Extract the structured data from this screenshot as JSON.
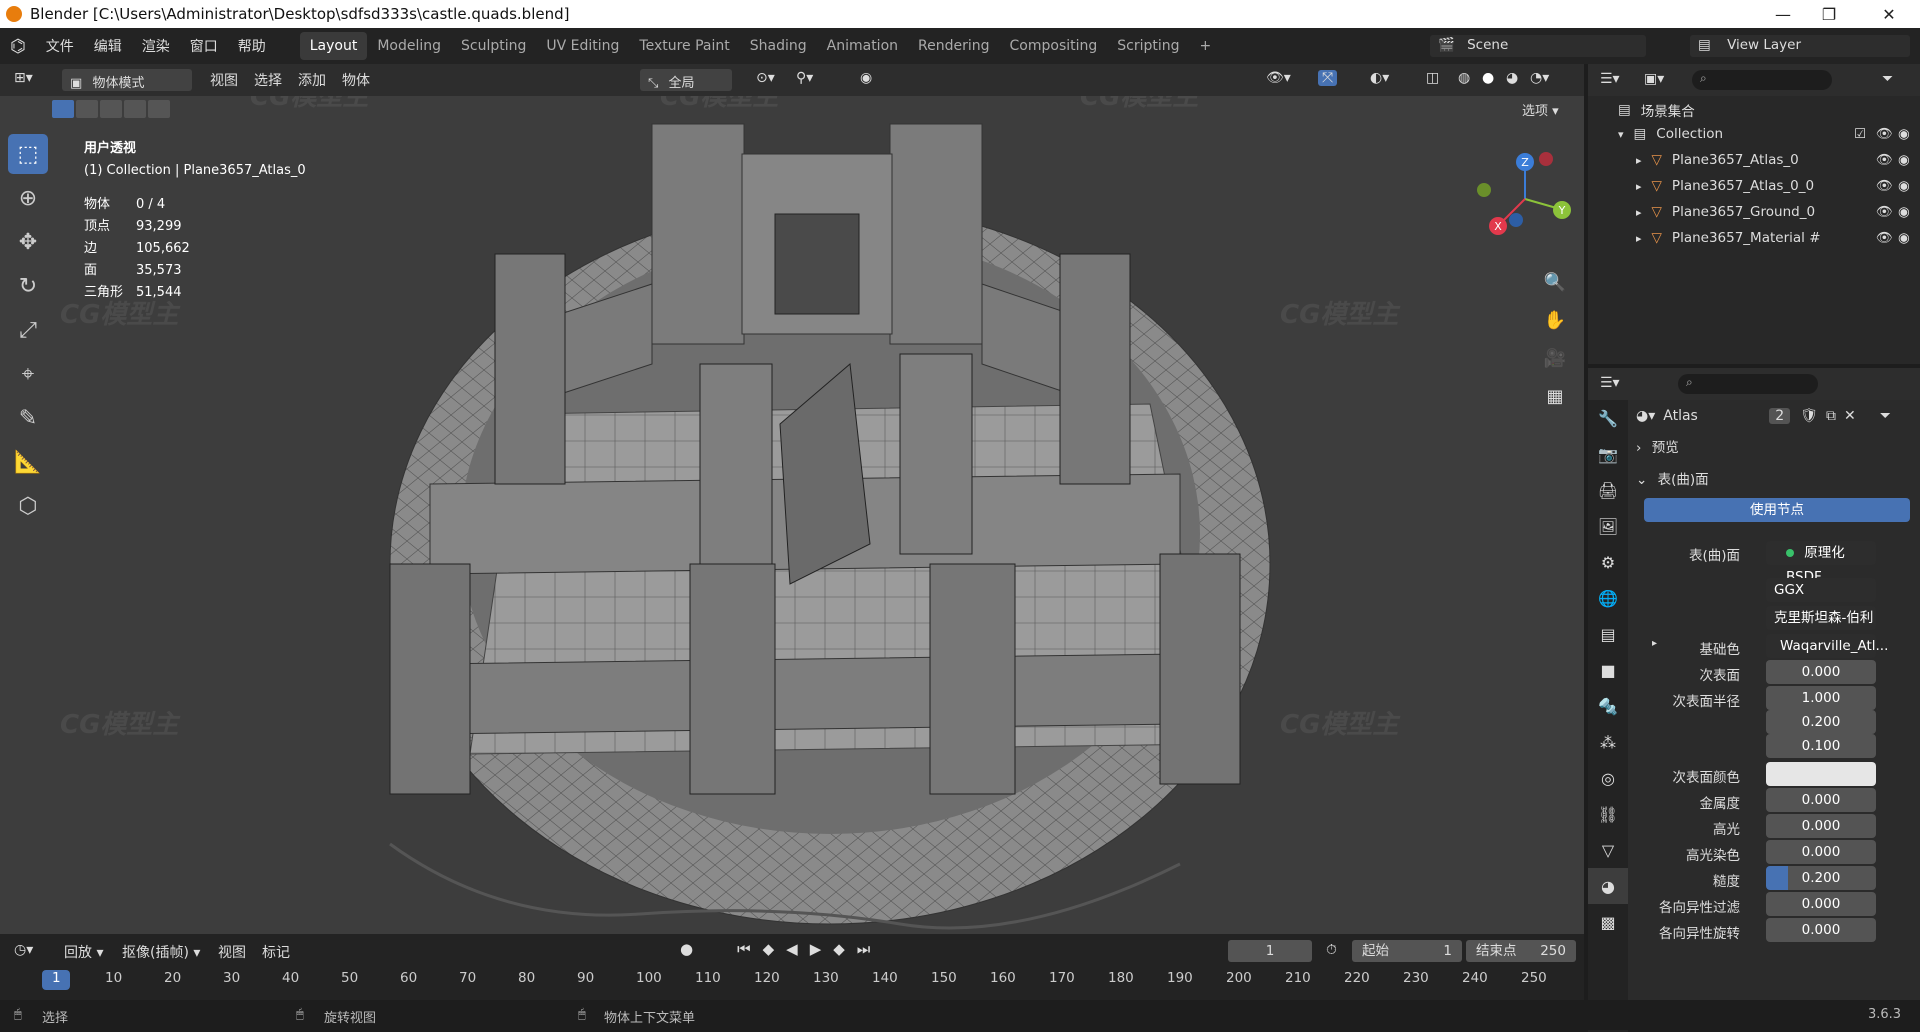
{
  "window": {
    "title": "Blender [C:\\Users\\Administrator\\Desktop\\sdfsd333s\\castle.quads.blend]",
    "minimize": "—",
    "maximize": "❐",
    "close": "✕"
  },
  "menu": [
    "文件",
    "编辑",
    "渲染",
    "窗口",
    "帮助"
  ],
  "workspaces": [
    "Layout",
    "Modeling",
    "Sculpting",
    "UV Editing",
    "Texture Paint",
    "Shading",
    "Animation",
    "Rendering",
    "Compositing",
    "Scripting",
    "+"
  ],
  "scene": {
    "name": "Scene",
    "view_layer": "View Layer"
  },
  "viewport": {
    "mode": "物体模式",
    "menus": [
      "视图",
      "选择",
      "添加",
      "物体"
    ],
    "orientation": "全局",
    "options": "选项",
    "header_title": "用户透视",
    "header_sub": "(1) Collection | Plane3657_Atlas_0",
    "stats": [
      {
        "k": "物体",
        "v": "0 / 4"
      },
      {
        "k": "顶点",
        "v": "93,299"
      },
      {
        "k": "边",
        "v": "105,662"
      },
      {
        "k": "面",
        "v": "35,573"
      },
      {
        "k": "三角形",
        "v": "51,544"
      }
    ],
    "gizmo": {
      "x": "X",
      "y": "Y",
      "z": "Z"
    }
  },
  "outliner": {
    "root": "场景集合",
    "collection": "Collection",
    "items": [
      "Plane3657_Atlas_0",
      "Plane3657_Atlas_0_0",
      "Plane3657_Ground_0",
      "Plane3657_Material #"
    ]
  },
  "properties": {
    "material": "Atlas",
    "users": "2",
    "preview": "预览",
    "surface_panel": "表(曲)面",
    "use_nodes": "使用节点",
    "surface_label": "表(曲)面",
    "surface_value": "原理化BSDF",
    "dist": "GGX",
    "sss_method": "克里斯坦森-伯利",
    "fields": [
      {
        "label": "基础色",
        "value": "Waqarville_Atl..."
      },
      {
        "label": "次表面",
        "value": "0.000"
      },
      {
        "label": "次表面半径",
        "value": "1.000"
      },
      {
        "label": "",
        "value": "0.200"
      },
      {
        "label": "",
        "value": "0.100"
      },
      {
        "label": "次表面颜色",
        "value": ""
      },
      {
        "label": "金属度",
        "value": "0.000"
      },
      {
        "label": "高光",
        "value": "0.000"
      },
      {
        "label": "高光染色",
        "value": "0.000"
      },
      {
        "label": "糙度",
        "value": "0.200"
      },
      {
        "label": "各向异性过滤",
        "value": "0.000"
      },
      {
        "label": "各向异性旋转",
        "value": "0.000"
      }
    ]
  },
  "timeline": {
    "playback": "回放",
    "keying": "抠像(插帧)",
    "view": "视图",
    "marker": "标记",
    "current": "1",
    "start_label": "起始",
    "start": "1",
    "end_label": "结束点",
    "end": "250",
    "ticks": [
      "1",
      "10",
      "20",
      "30",
      "40",
      "50",
      "60",
      "70",
      "80",
      "90",
      "100",
      "110",
      "120",
      "130",
      "140",
      "150",
      "160",
      "170",
      "180",
      "190",
      "200",
      "210",
      "220",
      "230",
      "240",
      "250"
    ]
  },
  "status": {
    "select": "选择",
    "rotate": "旋转视图",
    "context": "物体上下文菜单",
    "version": "3.6.3"
  },
  "watermark": "CG模型主"
}
